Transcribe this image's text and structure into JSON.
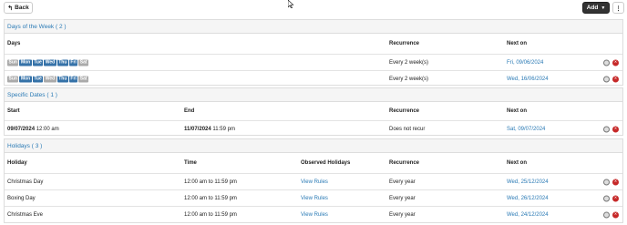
{
  "toolbar": {
    "back_label": "Back",
    "add_label": "Add",
    "more_label": "⋮"
  },
  "days_section": {
    "title": "Days of the Week ( 2 )",
    "headers": {
      "days": "Days",
      "recurrence": "Recurrence",
      "next_on": "Next on"
    },
    "rows": [
      {
        "days": [
          {
            "label": "Sun",
            "on": false
          },
          {
            "label": "Mon",
            "on": true
          },
          {
            "label": "Tue",
            "on": true
          },
          {
            "label": "Wed",
            "on": true
          },
          {
            "label": "Thu",
            "on": true
          },
          {
            "label": "Fri",
            "on": true
          },
          {
            "label": "Sat",
            "on": false
          }
        ],
        "recurrence": "Every 2 week(s)",
        "next_on": "Fri, 09/06/2024"
      },
      {
        "days": [
          {
            "label": "Sun",
            "on": false
          },
          {
            "label": "Mon",
            "on": true
          },
          {
            "label": "Tue",
            "on": true
          },
          {
            "label": "Wed",
            "on": false
          },
          {
            "label": "Thu",
            "on": true
          },
          {
            "label": "Fri",
            "on": true
          },
          {
            "label": "Sat",
            "on": false
          }
        ],
        "recurrence": "Every 2 week(s)",
        "next_on": "Wed, 16/06/2024"
      }
    ]
  },
  "dates_section": {
    "title": "Specific Dates ( 1 )",
    "headers": {
      "start": "Start",
      "end": "End",
      "recurrence": "Recurrence",
      "next_on": "Next on"
    },
    "rows": [
      {
        "start_date": "09/07/2024",
        "start_time": " 12:00 am",
        "end_date": "11/07/2024",
        "end_time": " 11:59 pm",
        "recurrence": "Does not recur",
        "next_on": "Sat, 09/07/2024"
      }
    ]
  },
  "holidays_section": {
    "title": "Holidays ( 3 )",
    "headers": {
      "holiday": "Holiday",
      "time": "Time",
      "observed": "Observed Holidays",
      "recurrence": "Recurrence",
      "next_on": "Next on"
    },
    "rows": [
      {
        "holiday": "Christmas Day",
        "time": "12:00 am to 11:59 pm",
        "observed": "View Rules",
        "recurrence": "Every year",
        "next_on": "Wed, 25/12/2024"
      },
      {
        "holiday": "Boxing Day",
        "time": "12:00 am to 11:59 pm",
        "observed": "View Rules",
        "recurrence": "Every year",
        "next_on": "Wed, 26/12/2024"
      },
      {
        "holiday": "Christmas Eve",
        "time": "12:00 am to 11:59 pm",
        "observed": "View Rules",
        "recurrence": "Every year",
        "next_on": "Wed, 24/12/2024"
      }
    ]
  }
}
